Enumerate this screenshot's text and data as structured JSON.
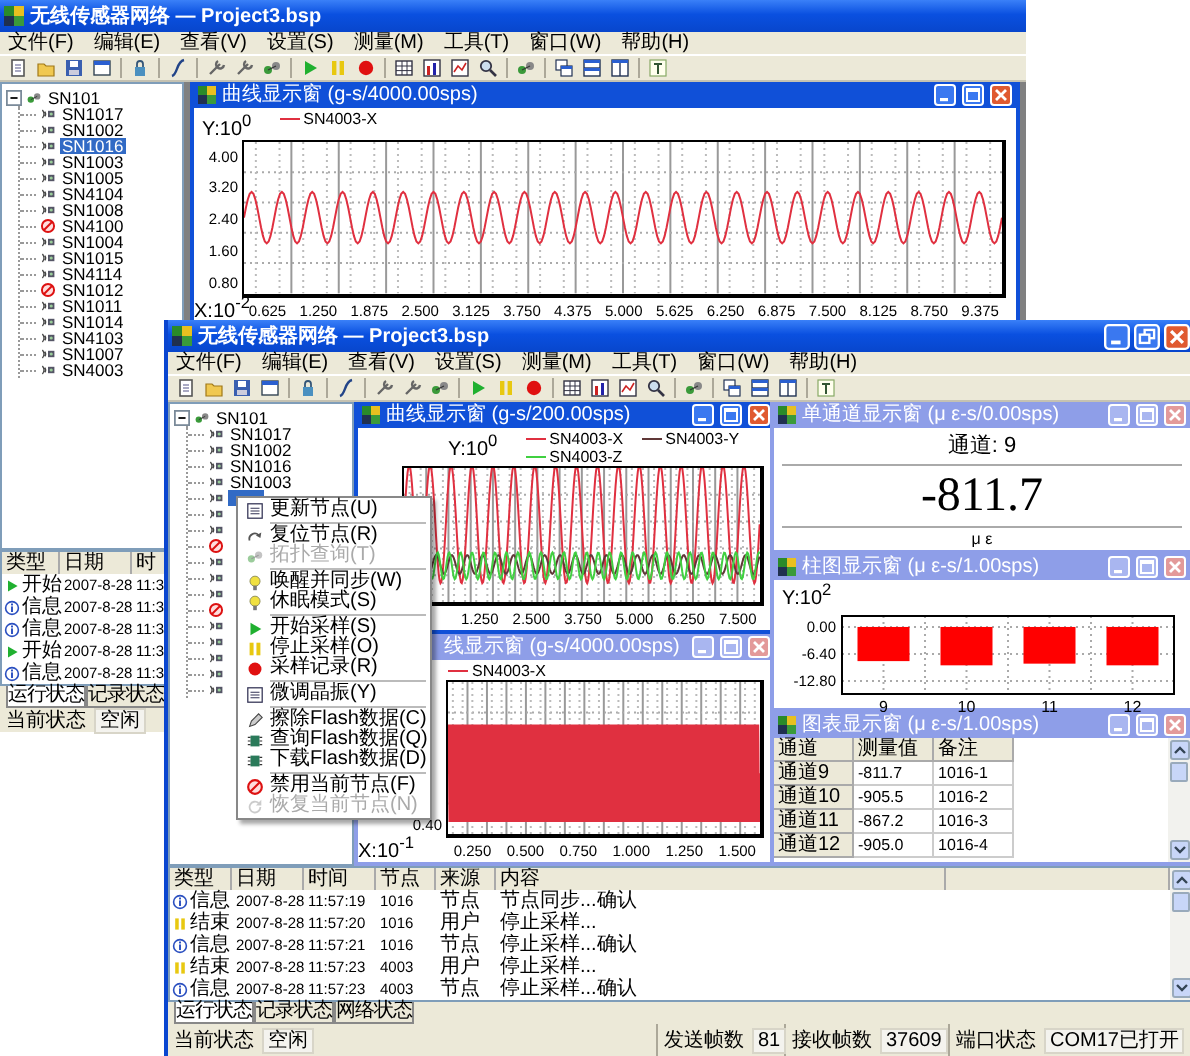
{
  "back_window": {
    "title": "无线传感器网络 — Project3.bsp",
    "menu": [
      "文件(F)",
      "编辑(E)",
      "查看(V)",
      "设置(S)",
      "测量(M)",
      "工具(T)",
      "窗口(W)",
      "帮助(H)"
    ],
    "tree": {
      "label": "SN101",
      "expanded": true,
      "children": [
        {
          "label": "SN1017",
          "kind": "node",
          "selected": false
        },
        {
          "label": "SN1002",
          "kind": "node",
          "selected": false
        },
        {
          "label": "SN1016",
          "kind": "node",
          "selected": true
        },
        {
          "label": "SN1003",
          "kind": "node",
          "selected": false
        },
        {
          "label": "SN1005",
          "kind": "node",
          "selected": false
        },
        {
          "label": "SN4104",
          "kind": "node",
          "selected": false
        },
        {
          "label": "SN1008",
          "kind": "node",
          "selected": false
        },
        {
          "label": "SN4100",
          "kind": "disabled",
          "selected": false
        },
        {
          "label": "SN1004",
          "kind": "node",
          "selected": false
        },
        {
          "label": "SN1015",
          "kind": "node",
          "selected": false
        },
        {
          "label": "SN4114",
          "kind": "node",
          "selected": false
        },
        {
          "label": "SN1012",
          "kind": "disabled",
          "selected": false
        },
        {
          "label": "SN1011",
          "kind": "node",
          "selected": false
        },
        {
          "label": "SN1014",
          "kind": "node",
          "selected": false
        },
        {
          "label": "SN4103",
          "kind": "node",
          "selected": false
        },
        {
          "label": "SN1007",
          "kind": "node",
          "selected": false
        },
        {
          "label": "SN4003",
          "kind": "node",
          "selected": false
        }
      ]
    },
    "curve_window": {
      "title": "曲线显示窗 (g-s/4000.00sps)",
      "active": true,
      "y_label": "Y:10$^{0}$",
      "legend": [
        {
          "label": "SN4003-X",
          "color": "#e03040"
        }
      ],
      "y_ticks": [
        "4.00",
        "3.20",
        "2.40",
        "1.60",
        "0.80"
      ],
      "x_label": "X:10$^{-2}$",
      "x_ticks": [
        "0.625",
        "1.250",
        "1.875",
        "2.500",
        "3.125",
        "3.750",
        "4.375",
        "5.000",
        "5.625",
        "6.250",
        "6.875",
        "7.500",
        "8.125",
        "8.750",
        "9.375"
      ]
    },
    "log": {
      "columns": [
        "类型",
        "日期",
        "时"
      ],
      "rows": [
        {
          "kind": "start",
          "cells": [
            "开始",
            "2007-8-28",
            "11:3"
          ]
        },
        {
          "kind": "info",
          "cells": [
            "信息",
            "2007-8-28",
            "11:3"
          ]
        },
        {
          "kind": "info",
          "cells": [
            "信息",
            "2007-8-28",
            "11:3"
          ]
        },
        {
          "kind": "start",
          "cells": [
            "开始",
            "2007-8-28",
            "11:3"
          ]
        },
        {
          "kind": "info",
          "cells": [
            "信息",
            "2007-8-28",
            "11:3"
          ]
        }
      ]
    },
    "tabs": [
      {
        "label": "运行状态",
        "selected": true
      },
      {
        "label": "记录状态",
        "selected": false
      }
    ],
    "status_bar": [
      {
        "label": "当前状态",
        "value": "空闲"
      }
    ]
  },
  "front_window": {
    "title": "无线传感器网络 — Project3.bsp",
    "menu": [
      "文件(F)",
      "编辑(E)",
      "查看(V)",
      "设置(S)",
      "测量(M)",
      "工具(T)",
      "窗口(W)",
      "帮助(H)"
    ],
    "tree": {
      "label": "SN101",
      "expanded": true,
      "children": [
        {
          "label": "SN1017",
          "kind": "node",
          "selected": false
        },
        {
          "label": "SN1002",
          "kind": "node",
          "selected": false
        },
        {
          "label": "SN1016",
          "kind": "node",
          "selected": false
        },
        {
          "label": "SN1003",
          "kind": "node",
          "selected": false
        },
        {
          "kind": "node",
          "selected": true
        },
        {
          "kind": "node",
          "selected": false
        },
        {
          "kind": "node",
          "selected": false
        },
        {
          "kind": "disabled",
          "selected": false
        },
        {
          "kind": "node",
          "selected": false
        },
        {
          "kind": "node",
          "selected": false
        },
        {
          "kind": "node",
          "selected": false
        },
        {
          "kind": "disabled",
          "selected": false
        },
        {
          "kind": "node",
          "selected": false
        },
        {
          "kind": "node",
          "selected": false
        },
        {
          "kind": "node",
          "selected": false
        },
        {
          "kind": "node",
          "selected": false
        },
        {
          "kind": "node",
          "selected": false
        }
      ]
    },
    "context_menu": [
      {
        "kind": "item",
        "label": "更新节点(U)",
        "disabled": false
      },
      {
        "kind": "separator"
      },
      {
        "kind": "item",
        "label": "复位节点(R)",
        "disabled": false
      },
      {
        "kind": "item",
        "label": "拓扑查询(T)",
        "disabled": true
      },
      {
        "kind": "separator"
      },
      {
        "kind": "item",
        "label": "唤醒并同步(W)",
        "disabled": false
      },
      {
        "kind": "item",
        "label": "休眠模式(S)",
        "disabled": false
      },
      {
        "kind": "separator"
      },
      {
        "kind": "item",
        "label": "开始采样(S)",
        "disabled": false
      },
      {
        "kind": "item",
        "label": "停止采样(O)",
        "disabled": false
      },
      {
        "kind": "item",
        "label": "采样记录(R)",
        "disabled": false
      },
      {
        "kind": "separator"
      },
      {
        "kind": "item",
        "label": "微调晶振(Y)",
        "disabled": false
      },
      {
        "kind": "separator"
      },
      {
        "kind": "item",
        "label": "擦除Flash数据(C)",
        "disabled": false
      },
      {
        "kind": "item",
        "label": "查询Flash数据(Q)",
        "disabled": false
      },
      {
        "kind": "item",
        "label": "下载Flash数据(D)",
        "disabled": false
      },
      {
        "kind": "separator"
      },
      {
        "kind": "item",
        "label": "禁用当前节点(F)",
        "disabled": false
      },
      {
        "kind": "item",
        "label": "恢复当前节点(N)",
        "disabled": true
      }
    ],
    "curve_windows": [
      {
        "title": "曲线显示窗 (g-s/200.00sps)",
        "active": true,
        "y_label": "Y:10$^{0}$",
        "legend": [
          {
            "label": "SN4003-X",
            "color": "#e03040"
          },
          {
            "label": "SN4003-Y",
            "color": "#603838"
          },
          {
            "label": "SN4003-Z",
            "color": "#40d040"
          }
        ],
        "x_ticks": [
          "1.250",
          "2.500",
          "3.750",
          "5.000",
          "6.250",
          "7.500"
        ]
      },
      {
        "title": "线显示窗 (g-s/4000.00sps)",
        "active": false,
        "legend": [
          {
            "label": "SN4003-X",
            "color": "#e03040"
          }
        ],
        "y_ticks": [
          "0.40"
        ],
        "x_label": "X:10$^{-1}$",
        "x_ticks": [
          "0.250",
          "0.500",
          "0.750",
          "1.000",
          "1.250",
          "1.500"
        ]
      }
    ],
    "single_value_window": {
      "title": "单通道显示窗 (μ ε-s/0.00sps)",
      "active": false,
      "channel": "通道: 9",
      "value": "-811.7",
      "unit": "μ ε"
    },
    "bar_window": {
      "title": "柱图显示窗 (μ ε-s/1.00sps)",
      "active": false,
      "chart_data": {
        "type": "bar",
        "ylabel": "Y:10$^{2}$",
        "categories": [
          "9",
          "10",
          "11",
          "12"
        ],
        "values": [
          -8.1,
          -9.1,
          -8.7,
          -9.1
        ],
        "ylim": [
          -15.9,
          2.6
        ],
        "grid": true,
        "yticks": [
          {
            "value": 0,
            "label": "0.00"
          },
          {
            "value": -6.4,
            "label": "-6.40"
          },
          {
            "value": -12.8,
            "label": "-12.80"
          }
        ]
      }
    },
    "table_window": {
      "title": "图表显示窗 (μ ε-s/1.00sps)",
      "active": false,
      "columns": [
        "通道",
        "测量值",
        "备注"
      ],
      "rows": [
        [
          "通道9",
          "-811.7",
          "1016-1"
        ],
        [
          "通道10",
          "-905.5",
          "1016-2"
        ],
        [
          "通道11",
          "-867.2",
          "1016-3"
        ],
        [
          "通道12",
          "-905.0",
          "1016-4"
        ]
      ]
    },
    "log": {
      "columns": [
        "类型",
        "日期",
        "时间",
        "节点",
        "来源",
        "内容"
      ],
      "rows": [
        {
          "kind": "info",
          "cells": [
            "信息",
            "2007-8-28",
            "11:57:19",
            "1016",
            "节点",
            "节点同步...确认"
          ]
        },
        {
          "kind": "end",
          "cells": [
            "结束",
            "2007-8-28",
            "11:57:20",
            "1016",
            "用户",
            "停止采样..."
          ]
        },
        {
          "kind": "info",
          "cells": [
            "信息",
            "2007-8-28",
            "11:57:21",
            "1016",
            "节点",
            "停止采样...确认"
          ]
        },
        {
          "kind": "end",
          "cells": [
            "结束",
            "2007-8-28",
            "11:57:23",
            "4003",
            "用户",
            "停止采样..."
          ]
        },
        {
          "kind": "info",
          "cells": [
            "信息",
            "2007-8-28",
            "11:57:23",
            "4003",
            "节点",
            "停止采样...确认"
          ]
        }
      ]
    },
    "tabs": [
      {
        "label": "运行状态",
        "selected": true
      },
      {
        "label": "记录状态",
        "selected": false
      },
      {
        "label": "网络状态",
        "selected": false
      }
    ],
    "status_bar": [
      {
        "label": "当前状态",
        "value": "空闲"
      },
      {
        "label": "发送帧数",
        "value": "81"
      },
      {
        "label": "接收帧数",
        "value": "37609"
      },
      {
        "label": "端口状态",
        "value": "COM17已打开"
      }
    ]
  }
}
